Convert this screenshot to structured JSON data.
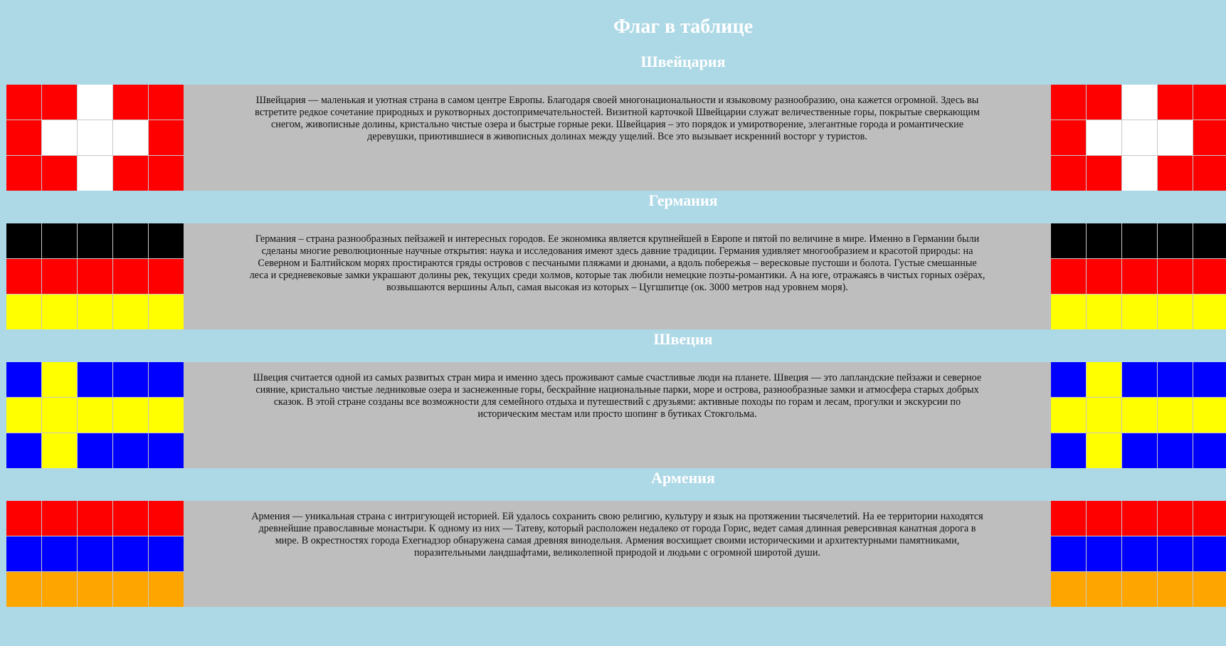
{
  "page": {
    "title": "Флаг в таблице"
  },
  "colors": {
    "background": "#add8e6",
    "description_bg": "#bebebe",
    "red": "#ff0000",
    "white": "#ffffff",
    "black": "#000000",
    "yellow": "#ffff00",
    "blue": "#0000ff",
    "orange": "#ffa500"
  },
  "countries": [
    {
      "name": "Швейцария",
      "flag": [
        [
          "#ff0000",
          "#ff0000",
          "#ffffff",
          "#ff0000",
          "#ff0000"
        ],
        [
          "#ff0000",
          "#ffffff",
          "#ffffff",
          "#ffffff",
          "#ff0000"
        ],
        [
          "#ff0000",
          "#ff0000",
          "#ffffff",
          "#ff0000",
          "#ff0000"
        ]
      ],
      "description": "Швейцария — маленькая и уютная страна в самом центре Европы. Благодаря своей многонациональности и языковому разнообразию, она кажется огромной. Здесь вы встретите редкое сочетание природных и рукотворных достопримечательностей. Визитной карточкой Швейцарии служат величественные горы, покрытые сверкающим снегом, живописные долины, кристально чистые озера и быстрые горные реки. Швейцария – это порядок и умиротворение, элегантные города и романтические деревушки, приютившиеся в живописных долинах между ущелий. Все это вызывает искренний восторг у туристов."
    },
    {
      "name": "Германия",
      "flag": [
        [
          "#000000",
          "#000000",
          "#000000",
          "#000000",
          "#000000"
        ],
        [
          "#ff0000",
          "#ff0000",
          "#ff0000",
          "#ff0000",
          "#ff0000"
        ],
        [
          "#ffff00",
          "#ffff00",
          "#ffff00",
          "#ffff00",
          "#ffff00"
        ]
      ],
      "description": "Германия – страна разнообразных пейзажей и интересных городов. Ее экономика является крупнейшей в Европе и пятой по величине в мире. Именно в Германии были сделаны многие революционные научные открытия: наука и исследования имеют здесь давние традиции. Германия удивляет многообразием и красотой природы: на Северном и Балтийском морях простираются гряды островов с песчаными пляжами и дюнами, а вдоль побережья – вересковые пустоши и болота. Густые смешанные леса и средневековые замки украшают долины рек, текущих среди холмов, которые так любили немецкие поэты-романтики. А на юге, отражаясь в чистых горных озёрах, возвышаются вершины Альп, самая высокая из которых – Цугшпитце (ок. 3000 метров над уровнем моря)."
    },
    {
      "name": "Швеция",
      "flag": [
        [
          "#0000ff",
          "#ffff00",
          "#0000ff",
          "#0000ff",
          "#0000ff"
        ],
        [
          "#ffff00",
          "#ffff00",
          "#ffff00",
          "#ffff00",
          "#ffff00"
        ],
        [
          "#0000ff",
          "#ffff00",
          "#0000ff",
          "#0000ff",
          "#0000ff"
        ]
      ],
      "description": "Швеция считается одной из самых развитых стран мира и именно здесь проживают самые счастливые люди на планете. Швеция — это лапландские пейзажи и северное сияние, кристально чистые ледниковые озера и заснеженные горы, бескрайние национальные парки, море и острова, разнообразные замки и атмосфера старых добрых сказок. В этой стране созданы все возможности для семейного отдыха и путешествий с друзьями: активные походы по горам и лесам, прогулки и экскурсии по историческим местам или просто шопинг в бутиках Стокгольма."
    },
    {
      "name": "Армения",
      "flag": [
        [
          "#ff0000",
          "#ff0000",
          "#ff0000",
          "#ff0000",
          "#ff0000"
        ],
        [
          "#0000ff",
          "#0000ff",
          "#0000ff",
          "#0000ff",
          "#0000ff"
        ],
        [
          "#ffa500",
          "#ffa500",
          "#ffa500",
          "#ffa500",
          "#ffa500"
        ]
      ],
      "description": "Армения — уникальная страна с интригующей историей. Ей удалось сохранить свою религию, культуру и язык на протяжении тысячелетий. На ее территории находятся древнейшие православные монастыри. К одному из них — Татеву, который расположен недалеко от города Горис, ведет самая длинная реверсивная канатная дорога в мире. В окрестностях города Ехегнадзор обнаружена самая древняя винодельня. Армения восхищает своими историческими и архитектурными памятниками, поразительными ландшафтами, великолепной природой и людьми с огромной широтой души."
    }
  ]
}
